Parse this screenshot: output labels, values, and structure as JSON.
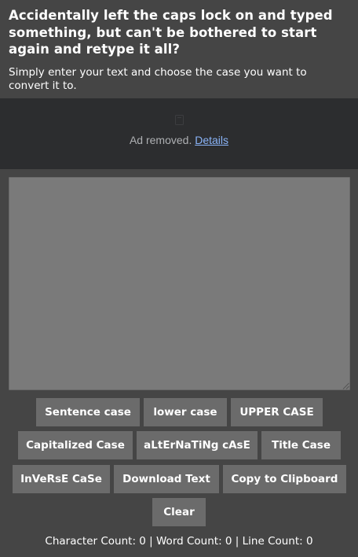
{
  "header": {
    "headline": "Accidentally left the caps lock on and typed something, but can't be bothered to start again and retype it all?",
    "subline": "Simply enter your text and choose the case you want to convert it to."
  },
  "ad": {
    "removed_text": "Ad removed.",
    "details_link": "Details",
    "icon": "ad-placeholder-icon"
  },
  "editor": {
    "value": "",
    "placeholder": ""
  },
  "buttons": {
    "sentence_case": "Sentence case",
    "lower_case": "lower case",
    "upper_case": "UPPER CASE",
    "capitalized_case": "Capitalized Case",
    "alternating_case": "aLtErNaTiNg cAsE",
    "title_case": "Title Case",
    "inverse_case": "InVeRsE CaSe",
    "download_text": "Download Text",
    "copy_to_clipboard": "Copy to Clipboard",
    "clear": "Clear"
  },
  "counts": {
    "text": "Character Count: 0 | Word Count: 0 | Line Count: 0"
  },
  "colors": {
    "page_background": "#454545",
    "ad_background": "#2c2d2f",
    "editor_background": "#7a7a7a",
    "button_background": "#6b6b6b",
    "link": "#8ab4f8"
  }
}
